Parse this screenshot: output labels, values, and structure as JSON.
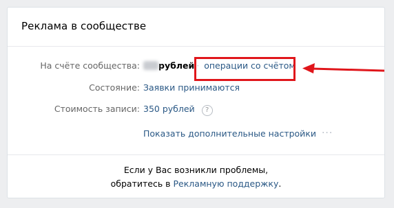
{
  "card": {
    "title": "Реклама в сообществе"
  },
  "balance": {
    "label": "На счёте сообщества:",
    "amount_unit": "рублей",
    "separator": "·",
    "operations_link": "операции со счётом"
  },
  "status": {
    "label": "Состояние:",
    "value": "Заявки принимаются"
  },
  "price": {
    "label": "Стоимость записи:",
    "value": "350 рублей",
    "help_icon": "?"
  },
  "more_settings": {
    "label": "Показать дополнительные настройки",
    "dots": "···"
  },
  "footer": {
    "line1": "Если у Вас возникли проблемы,",
    "line2_prefix": "обратитесь в ",
    "support_link": "Рекламную поддержку",
    "line2_suffix": "."
  },
  "annotation": {
    "highlight_color": "#e0161b"
  }
}
